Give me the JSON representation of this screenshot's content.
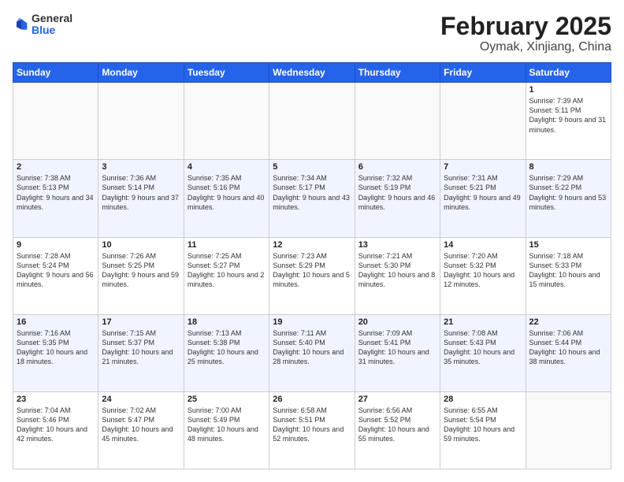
{
  "header": {
    "logo_general": "General",
    "logo_blue": "Blue",
    "month_title": "February 2025",
    "location": "Oymak, Xinjiang, China"
  },
  "days_of_week": [
    "Sunday",
    "Monday",
    "Tuesday",
    "Wednesday",
    "Thursday",
    "Friday",
    "Saturday"
  ],
  "weeks": [
    {
      "alt": false,
      "days": [
        {
          "num": "",
          "info": ""
        },
        {
          "num": "",
          "info": ""
        },
        {
          "num": "",
          "info": ""
        },
        {
          "num": "",
          "info": ""
        },
        {
          "num": "",
          "info": ""
        },
        {
          "num": "",
          "info": ""
        },
        {
          "num": "1",
          "info": "Sunrise: 7:39 AM\nSunset: 5:11 PM\nDaylight: 9 hours and 31 minutes."
        }
      ]
    },
    {
      "alt": true,
      "days": [
        {
          "num": "2",
          "info": "Sunrise: 7:38 AM\nSunset: 5:13 PM\nDaylight: 9 hours and 34 minutes."
        },
        {
          "num": "3",
          "info": "Sunrise: 7:36 AM\nSunset: 5:14 PM\nDaylight: 9 hours and 37 minutes."
        },
        {
          "num": "4",
          "info": "Sunrise: 7:35 AM\nSunset: 5:16 PM\nDaylight: 9 hours and 40 minutes."
        },
        {
          "num": "5",
          "info": "Sunrise: 7:34 AM\nSunset: 5:17 PM\nDaylight: 9 hours and 43 minutes."
        },
        {
          "num": "6",
          "info": "Sunrise: 7:32 AM\nSunset: 5:19 PM\nDaylight: 9 hours and 46 minutes."
        },
        {
          "num": "7",
          "info": "Sunrise: 7:31 AM\nSunset: 5:21 PM\nDaylight: 9 hours and 49 minutes."
        },
        {
          "num": "8",
          "info": "Sunrise: 7:29 AM\nSunset: 5:22 PM\nDaylight: 9 hours and 53 minutes."
        }
      ]
    },
    {
      "alt": false,
      "days": [
        {
          "num": "9",
          "info": "Sunrise: 7:28 AM\nSunset: 5:24 PM\nDaylight: 9 hours and 56 minutes."
        },
        {
          "num": "10",
          "info": "Sunrise: 7:26 AM\nSunset: 5:25 PM\nDaylight: 9 hours and 59 minutes."
        },
        {
          "num": "11",
          "info": "Sunrise: 7:25 AM\nSunset: 5:27 PM\nDaylight: 10 hours and 2 minutes."
        },
        {
          "num": "12",
          "info": "Sunrise: 7:23 AM\nSunset: 5:29 PM\nDaylight: 10 hours and 5 minutes."
        },
        {
          "num": "13",
          "info": "Sunrise: 7:21 AM\nSunset: 5:30 PM\nDaylight: 10 hours and 8 minutes."
        },
        {
          "num": "14",
          "info": "Sunrise: 7:20 AM\nSunset: 5:32 PM\nDaylight: 10 hours and 12 minutes."
        },
        {
          "num": "15",
          "info": "Sunrise: 7:18 AM\nSunset: 5:33 PM\nDaylight: 10 hours and 15 minutes."
        }
      ]
    },
    {
      "alt": true,
      "days": [
        {
          "num": "16",
          "info": "Sunrise: 7:16 AM\nSunset: 5:35 PM\nDaylight: 10 hours and 18 minutes."
        },
        {
          "num": "17",
          "info": "Sunrise: 7:15 AM\nSunset: 5:37 PM\nDaylight: 10 hours and 21 minutes."
        },
        {
          "num": "18",
          "info": "Sunrise: 7:13 AM\nSunset: 5:38 PM\nDaylight: 10 hours and 25 minutes."
        },
        {
          "num": "19",
          "info": "Sunrise: 7:11 AM\nSunset: 5:40 PM\nDaylight: 10 hours and 28 minutes."
        },
        {
          "num": "20",
          "info": "Sunrise: 7:09 AM\nSunset: 5:41 PM\nDaylight: 10 hours and 31 minutes."
        },
        {
          "num": "21",
          "info": "Sunrise: 7:08 AM\nSunset: 5:43 PM\nDaylight: 10 hours and 35 minutes."
        },
        {
          "num": "22",
          "info": "Sunrise: 7:06 AM\nSunset: 5:44 PM\nDaylight: 10 hours and 38 minutes."
        }
      ]
    },
    {
      "alt": false,
      "days": [
        {
          "num": "23",
          "info": "Sunrise: 7:04 AM\nSunset: 5:46 PM\nDaylight: 10 hours and 42 minutes."
        },
        {
          "num": "24",
          "info": "Sunrise: 7:02 AM\nSunset: 5:47 PM\nDaylight: 10 hours and 45 minutes."
        },
        {
          "num": "25",
          "info": "Sunrise: 7:00 AM\nSunset: 5:49 PM\nDaylight: 10 hours and 48 minutes."
        },
        {
          "num": "26",
          "info": "Sunrise: 6:58 AM\nSunset: 5:51 PM\nDaylight: 10 hours and 52 minutes."
        },
        {
          "num": "27",
          "info": "Sunrise: 6:56 AM\nSunset: 5:52 PM\nDaylight: 10 hours and 55 minutes."
        },
        {
          "num": "28",
          "info": "Sunrise: 6:55 AM\nSunset: 5:54 PM\nDaylight: 10 hours and 59 minutes."
        },
        {
          "num": "",
          "info": ""
        }
      ]
    }
  ]
}
